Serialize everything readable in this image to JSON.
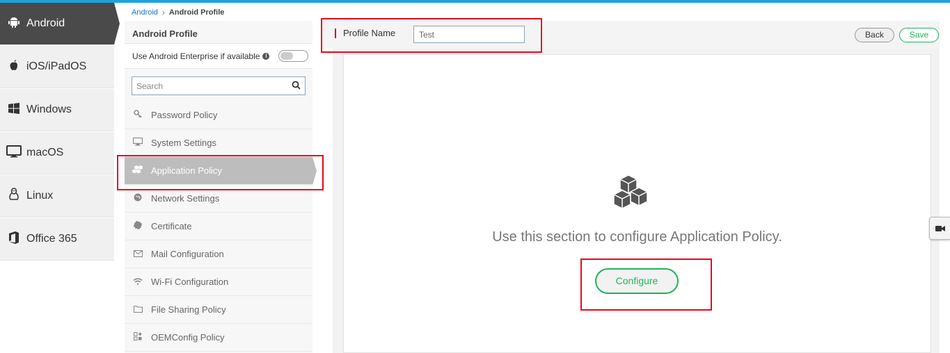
{
  "os_sidebar": {
    "items": [
      {
        "label": "Android",
        "icon": "android-icon",
        "active": true
      },
      {
        "label": "iOS/iPadOS",
        "icon": "apple-icon",
        "active": false
      },
      {
        "label": "Windows",
        "icon": "windows-icon",
        "active": false
      },
      {
        "label": "macOS",
        "icon": "monitor-icon",
        "active": false
      },
      {
        "label": "Linux",
        "icon": "linux-icon",
        "active": false
      },
      {
        "label": "Office 365",
        "icon": "office-icon",
        "active": false
      }
    ]
  },
  "breadcrumb": {
    "parent": "Android",
    "current": "Android Profile"
  },
  "policy_panel": {
    "title": "Android Profile",
    "enterprise_label": "Use Android Enterprise if available",
    "enterprise_enabled": false,
    "search_placeholder": "Search",
    "items": [
      {
        "label": "Password Policy",
        "icon": "key-icon"
      },
      {
        "label": "System Settings",
        "icon": "monitor-icon"
      },
      {
        "label": "Application Policy",
        "icon": "cubes-icon",
        "active": true
      },
      {
        "label": "Network Settings",
        "icon": "globe-icon"
      },
      {
        "label": "Certificate",
        "icon": "certificate-icon"
      },
      {
        "label": "Mail Configuration",
        "icon": "envelope-icon"
      },
      {
        "label": "Wi-Fi Configuration",
        "icon": "wifi-icon"
      },
      {
        "label": "File Sharing Policy",
        "icon": "folder-icon"
      },
      {
        "label": "OEMConfig Policy",
        "icon": "oemconfig-icon"
      }
    ]
  },
  "header": {
    "profile_name_label": "Profile Name",
    "profile_name_value": "Test",
    "back_label": "Back",
    "save_label": "Save"
  },
  "main": {
    "message": "Use this section to configure Application Policy.",
    "configure_label": "Configure"
  },
  "colors": {
    "accent_blue": "#1aa3e0",
    "active_os": "#4a4a4a",
    "active_menu": "#bdbdbd",
    "green": "#1fb35b",
    "annotation_red": "#e8081c"
  }
}
